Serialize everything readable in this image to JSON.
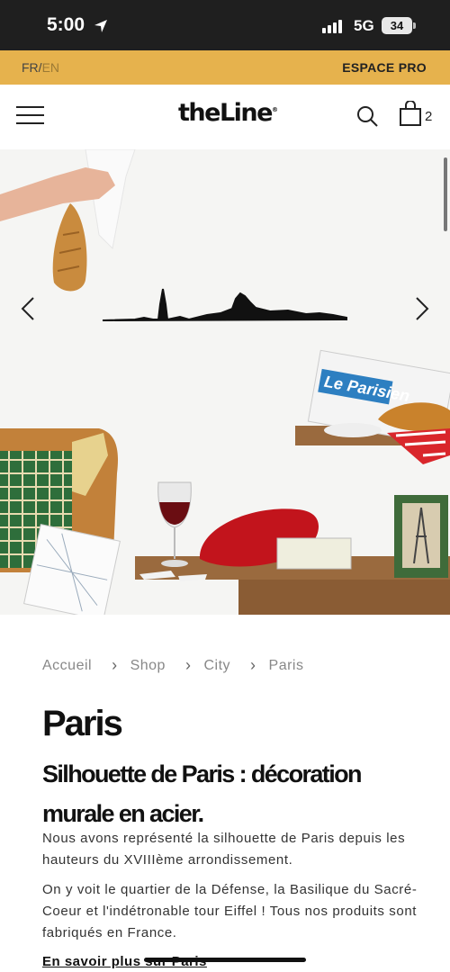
{
  "status_bar": {
    "time": "5:00",
    "network": "5G",
    "battery": "34"
  },
  "pro_bar": {
    "lang_active": "FR",
    "lang_separator": "/",
    "lang_inactive": "EN",
    "pro_label": "ESPACE PRO"
  },
  "header": {
    "logo_text": "theLine",
    "cart_count": "2"
  },
  "breadcrumb": {
    "items": [
      "Accueil",
      "Shop",
      "City",
      "Paris"
    ]
  },
  "product": {
    "title": "Paris",
    "subtitle": "Silhouette de Paris : décoration murale en acier.",
    "description_1": "Nous avons représenté la silhouette de Paris depuis les hauteurs du XVIIIème arrondissement.",
    "description_2": "On y voit le quartier de la Défense, la Basilique du Sacré-Coeur et l'indétronable tour Eiffel ! Tous nos produits sont fabriqués en France.",
    "more_link": "En savoir plus sur Paris"
  },
  "hero": {
    "newspaper_text": "Le Parisien"
  },
  "colors": {
    "pro_bar": "#e6b24d",
    "status_bar": "#1f1f1f"
  }
}
